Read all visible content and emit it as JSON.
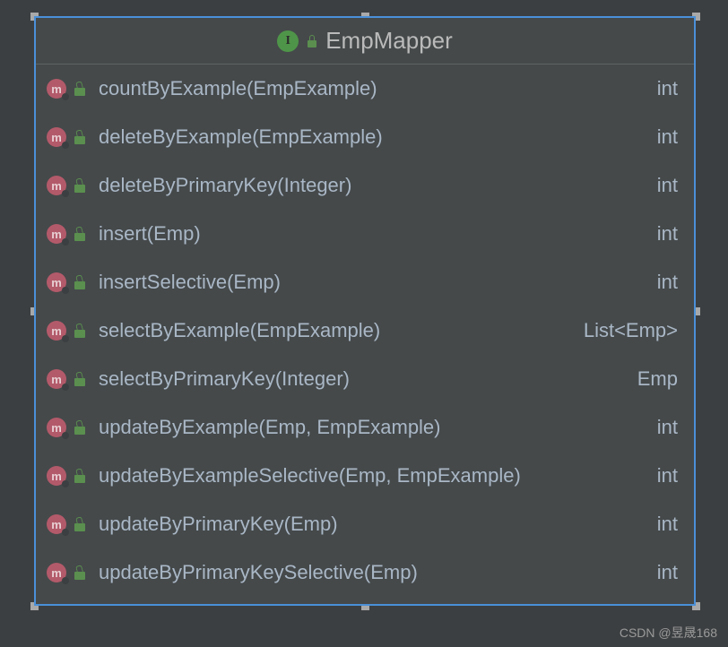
{
  "class": {
    "name": "EmpMapper",
    "icon_letter": "I",
    "methods": [
      {
        "signature": "countByExample(EmpExample)",
        "returnType": "int"
      },
      {
        "signature": "deleteByExample(EmpExample)",
        "returnType": "int"
      },
      {
        "signature": "deleteByPrimaryKey(Integer)",
        "returnType": "int"
      },
      {
        "signature": "insert(Emp)",
        "returnType": "int"
      },
      {
        "signature": "insertSelective(Emp)",
        "returnType": "int"
      },
      {
        "signature": "selectByExample(EmpExample)",
        "returnType": "List<Emp>"
      },
      {
        "signature": "selectByPrimaryKey(Integer)",
        "returnType": "Emp"
      },
      {
        "signature": "updateByExample(Emp, EmpExample)",
        "returnType": "int"
      },
      {
        "signature": "updateByExampleSelective(Emp, EmpExample)",
        "returnType": "int"
      },
      {
        "signature": "updateByPrimaryKey(Emp)",
        "returnType": "int"
      },
      {
        "signature": "updateByPrimaryKeySelective(Emp)",
        "returnType": "int"
      }
    ]
  },
  "method_icon_letter": "m",
  "watermark": "CSDN @昱晟168"
}
